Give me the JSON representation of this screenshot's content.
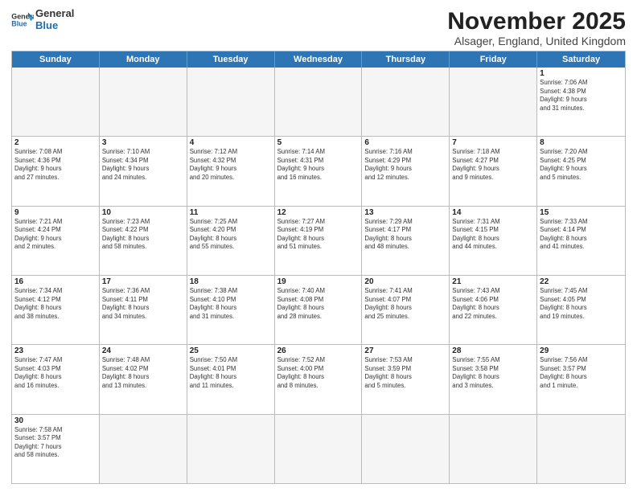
{
  "logo": {
    "line1": "General",
    "line2": "Blue"
  },
  "title": "November 2025",
  "location": "Alsager, England, United Kingdom",
  "header_days": [
    "Sunday",
    "Monday",
    "Tuesday",
    "Wednesday",
    "Thursday",
    "Friday",
    "Saturday"
  ],
  "weeks": [
    [
      {
        "day": "",
        "info": ""
      },
      {
        "day": "",
        "info": ""
      },
      {
        "day": "",
        "info": ""
      },
      {
        "day": "",
        "info": ""
      },
      {
        "day": "",
        "info": ""
      },
      {
        "day": "",
        "info": ""
      },
      {
        "day": "1",
        "info": "Sunrise: 7:06 AM\nSunset: 4:38 PM\nDaylight: 9 hours\nand 31 minutes."
      }
    ],
    [
      {
        "day": "2",
        "info": "Sunrise: 7:08 AM\nSunset: 4:36 PM\nDaylight: 9 hours\nand 27 minutes."
      },
      {
        "day": "3",
        "info": "Sunrise: 7:10 AM\nSunset: 4:34 PM\nDaylight: 9 hours\nand 24 minutes."
      },
      {
        "day": "4",
        "info": "Sunrise: 7:12 AM\nSunset: 4:32 PM\nDaylight: 9 hours\nand 20 minutes."
      },
      {
        "day": "5",
        "info": "Sunrise: 7:14 AM\nSunset: 4:31 PM\nDaylight: 9 hours\nand 16 minutes."
      },
      {
        "day": "6",
        "info": "Sunrise: 7:16 AM\nSunset: 4:29 PM\nDaylight: 9 hours\nand 12 minutes."
      },
      {
        "day": "7",
        "info": "Sunrise: 7:18 AM\nSunset: 4:27 PM\nDaylight: 9 hours\nand 9 minutes."
      },
      {
        "day": "8",
        "info": "Sunrise: 7:20 AM\nSunset: 4:25 PM\nDaylight: 9 hours\nand 5 minutes."
      }
    ],
    [
      {
        "day": "9",
        "info": "Sunrise: 7:21 AM\nSunset: 4:24 PM\nDaylight: 9 hours\nand 2 minutes."
      },
      {
        "day": "10",
        "info": "Sunrise: 7:23 AM\nSunset: 4:22 PM\nDaylight: 8 hours\nand 58 minutes."
      },
      {
        "day": "11",
        "info": "Sunrise: 7:25 AM\nSunset: 4:20 PM\nDaylight: 8 hours\nand 55 minutes."
      },
      {
        "day": "12",
        "info": "Sunrise: 7:27 AM\nSunset: 4:19 PM\nDaylight: 8 hours\nand 51 minutes."
      },
      {
        "day": "13",
        "info": "Sunrise: 7:29 AM\nSunset: 4:17 PM\nDaylight: 8 hours\nand 48 minutes."
      },
      {
        "day": "14",
        "info": "Sunrise: 7:31 AM\nSunset: 4:15 PM\nDaylight: 8 hours\nand 44 minutes."
      },
      {
        "day": "15",
        "info": "Sunrise: 7:33 AM\nSunset: 4:14 PM\nDaylight: 8 hours\nand 41 minutes."
      }
    ],
    [
      {
        "day": "16",
        "info": "Sunrise: 7:34 AM\nSunset: 4:12 PM\nDaylight: 8 hours\nand 38 minutes."
      },
      {
        "day": "17",
        "info": "Sunrise: 7:36 AM\nSunset: 4:11 PM\nDaylight: 8 hours\nand 34 minutes."
      },
      {
        "day": "18",
        "info": "Sunrise: 7:38 AM\nSunset: 4:10 PM\nDaylight: 8 hours\nand 31 minutes."
      },
      {
        "day": "19",
        "info": "Sunrise: 7:40 AM\nSunset: 4:08 PM\nDaylight: 8 hours\nand 28 minutes."
      },
      {
        "day": "20",
        "info": "Sunrise: 7:41 AM\nSunset: 4:07 PM\nDaylight: 8 hours\nand 25 minutes."
      },
      {
        "day": "21",
        "info": "Sunrise: 7:43 AM\nSunset: 4:06 PM\nDaylight: 8 hours\nand 22 minutes."
      },
      {
        "day": "22",
        "info": "Sunrise: 7:45 AM\nSunset: 4:05 PM\nDaylight: 8 hours\nand 19 minutes."
      }
    ],
    [
      {
        "day": "23",
        "info": "Sunrise: 7:47 AM\nSunset: 4:03 PM\nDaylight: 8 hours\nand 16 minutes."
      },
      {
        "day": "24",
        "info": "Sunrise: 7:48 AM\nSunset: 4:02 PM\nDaylight: 8 hours\nand 13 minutes."
      },
      {
        "day": "25",
        "info": "Sunrise: 7:50 AM\nSunset: 4:01 PM\nDaylight: 8 hours\nand 11 minutes."
      },
      {
        "day": "26",
        "info": "Sunrise: 7:52 AM\nSunset: 4:00 PM\nDaylight: 8 hours\nand 8 minutes."
      },
      {
        "day": "27",
        "info": "Sunrise: 7:53 AM\nSunset: 3:59 PM\nDaylight: 8 hours\nand 5 minutes."
      },
      {
        "day": "28",
        "info": "Sunrise: 7:55 AM\nSunset: 3:58 PM\nDaylight: 8 hours\nand 3 minutes."
      },
      {
        "day": "29",
        "info": "Sunrise: 7:56 AM\nSunset: 3:57 PM\nDaylight: 8 hours\nand 1 minute."
      }
    ],
    [
      {
        "day": "30",
        "info": "Sunrise: 7:58 AM\nSunset: 3:57 PM\nDaylight: 7 hours\nand 58 minutes."
      },
      {
        "day": "",
        "info": ""
      },
      {
        "day": "",
        "info": ""
      },
      {
        "day": "",
        "info": ""
      },
      {
        "day": "",
        "info": ""
      },
      {
        "day": "",
        "info": ""
      },
      {
        "day": "",
        "info": ""
      }
    ]
  ]
}
